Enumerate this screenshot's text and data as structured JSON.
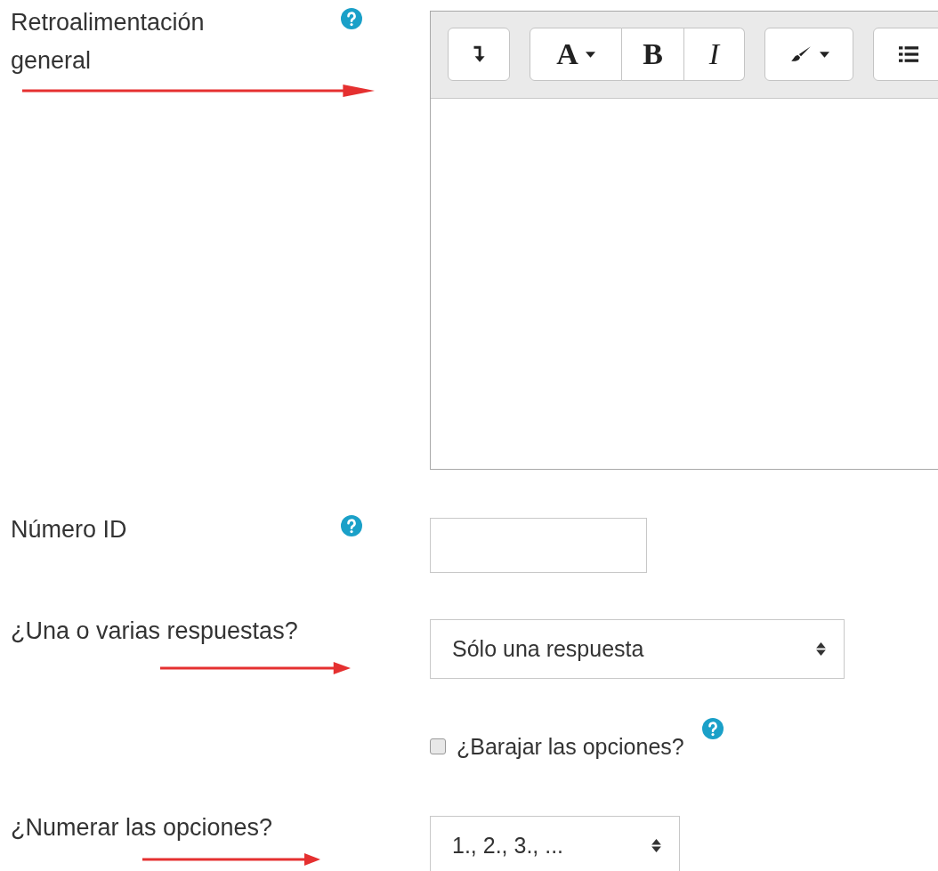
{
  "fields": [
    {
      "kind": "editor",
      "label": "Retroalimentación general",
      "help": true,
      "arrow": true,
      "toolbar": [
        [
          {
            "kind": "collapse"
          }
        ],
        [
          {
            "kind": "font",
            "label": "A"
          },
          {
            "kind": "bold",
            "label": "B"
          },
          {
            "kind": "italic",
            "label": "I"
          }
        ],
        [
          {
            "kind": "brush"
          }
        ],
        [
          {
            "kind": "list"
          }
        ]
      ]
    },
    {
      "kind": "text",
      "label": "Número ID",
      "help": true,
      "arrow": false
    },
    {
      "kind": "select",
      "label": "¿Una o varias respuestas?",
      "help": false,
      "arrow": true,
      "value": "Sólo una respuesta",
      "wide": true
    },
    {
      "kind": "checkbox",
      "label": "¿Barajar las opciones?",
      "help": true,
      "arrow": false,
      "checked": false
    },
    {
      "kind": "select",
      "label": "¿Numerar las opciones?",
      "help": false,
      "arrow": true,
      "value": "1., 2., 3., ...",
      "wide": false
    }
  ]
}
